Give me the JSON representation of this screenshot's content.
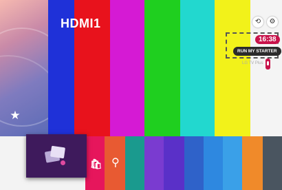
{
  "screen": {
    "source_title": "HDMI1",
    "clock": "16:38",
    "run_my_starter_label": "RUN MY STARTER",
    "channel_plus_label": "LG TV Plus"
  },
  "colors": {
    "bars": [
      "#1f31d8",
      "#e8121c",
      "#d51ad4",
      "#1fcf1f",
      "#22d8cf",
      "#f2f21a",
      "#f4f4f4"
    ],
    "accent": "#c8124a",
    "home_tile": "#3e1a5c",
    "launcher_tiles": [
      "#e6165c",
      "#e85a32",
      "#1a9a8e",
      "#7a3bd0",
      "#5a30c8",
      "#2f62c9",
      "#2e88e0",
      "#3aa0e8",
      "#f08a2a",
      "#4a5560"
    ]
  },
  "icons": {
    "favorite": "star-icon",
    "input": "input-icon",
    "settings": "gear-icon",
    "remote": "remote-icon",
    "home": "home-photos-icon",
    "shop": "shopping-bag-icon",
    "search": "search-icon"
  }
}
